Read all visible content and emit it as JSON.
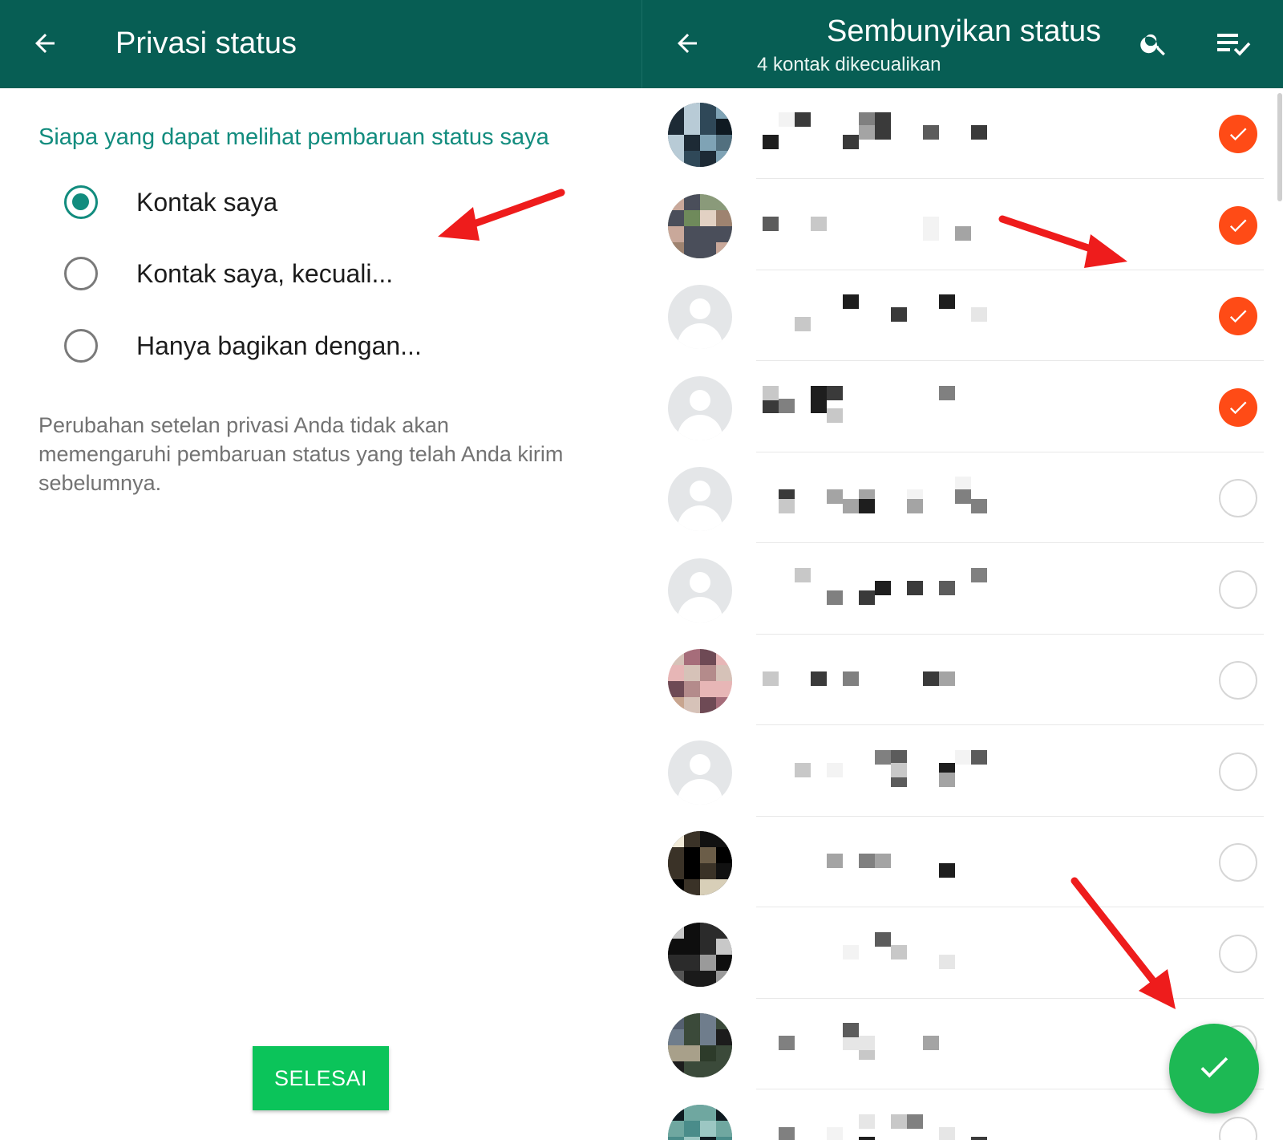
{
  "colors": {
    "appbar": "#075e54",
    "accent": "#128c7e",
    "check_on": "#ff4b16",
    "done_button": "#0bc45a",
    "fab": "#1db954",
    "annotation_arrow": "#ee1c1c"
  },
  "left": {
    "title": "Privasi status",
    "back_icon": "arrow-left-icon",
    "section_title": "Siapa yang dapat melihat pembaruan status saya",
    "options": [
      {
        "label": "Kontak saya",
        "checked": true
      },
      {
        "label": "Kontak saya, kecuali...",
        "checked": false
      },
      {
        "label": "Hanya bagikan dengan...",
        "checked": false
      }
    ],
    "note": "Perubahan setelan privasi Anda tidak akan memengaruhi pembaruan status yang telah Anda kirim sebelumnya.",
    "done_label": "SELESAI"
  },
  "right": {
    "title": "Sembunyikan status",
    "subtitle": "4 kontak dikecualikan",
    "back_icon": "arrow-left-icon",
    "search_icon": "search-icon",
    "select_all_icon": "select-all-icon",
    "fab_icon": "check-icon",
    "contacts": [
      {
        "avatar": "photo",
        "selected": true
      },
      {
        "avatar": "photo",
        "selected": true
      },
      {
        "avatar": "default",
        "selected": true
      },
      {
        "avatar": "default",
        "selected": true
      },
      {
        "avatar": "default",
        "selected": false
      },
      {
        "avatar": "default",
        "selected": false
      },
      {
        "avatar": "photo",
        "selected": false
      },
      {
        "avatar": "default",
        "selected": false
      },
      {
        "avatar": "photo",
        "selected": false
      },
      {
        "avatar": "photo",
        "selected": false
      },
      {
        "avatar": "photo",
        "selected": false
      },
      {
        "avatar": "photo",
        "selected": false
      }
    ]
  }
}
